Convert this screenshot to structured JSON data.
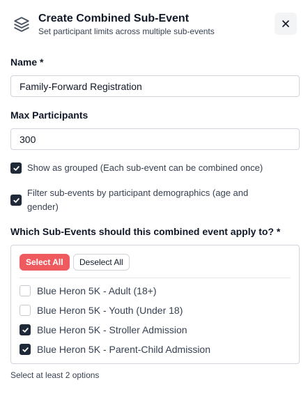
{
  "header": {
    "title": "Create Combined Sub-Event",
    "subtitle": "Set participant limits across multiple sub-events",
    "icon": "layers-icon",
    "close_icon": "close-icon"
  },
  "form": {
    "name_label": "Name *",
    "name_value": "Family-Forward Registration",
    "max_label": "Max Participants",
    "max_value": "300",
    "show_grouped": {
      "label": "Show as grouped (Each sub-event can be combined once)",
      "checked": true
    },
    "filter_demographics": {
      "label_line1": "Filter sub-events by participant demographics (age and",
      "label_line2": "gender)",
      "checked": true
    }
  },
  "subevents": {
    "question": "Which Sub-Events should this combined event apply to? *",
    "select_all_label": "Select All",
    "deselect_all_label": "Deselect All",
    "options": [
      {
        "label": "Blue Heron 5K - Adult (18+)",
        "checked": false
      },
      {
        "label": "Blue Heron 5K - Youth (Under 18)",
        "checked": false
      },
      {
        "label": "Blue Heron 5K - Stroller Admission",
        "checked": true
      },
      {
        "label": "Blue Heron 5K - Parent-Child Admission",
        "checked": true
      }
    ],
    "helper": "Select at least 2 options"
  },
  "colors": {
    "accent": "#ef5a5f",
    "checkbox_checked": "#1f2937"
  }
}
